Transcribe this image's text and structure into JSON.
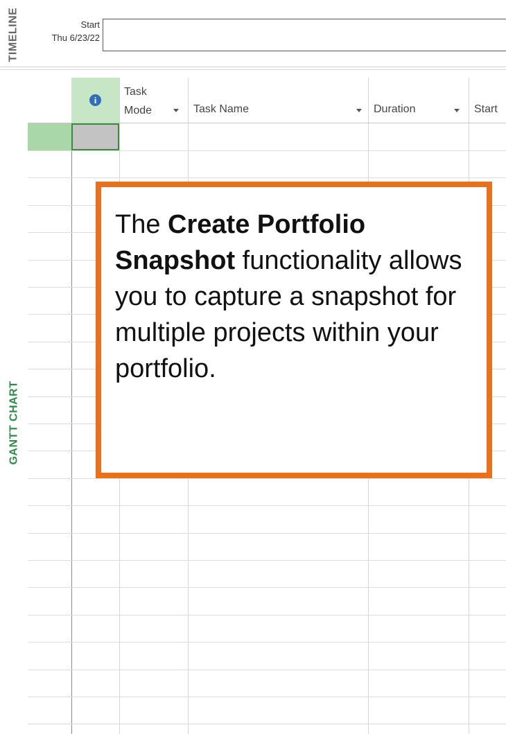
{
  "timeline": {
    "side_title": "TIMELINE",
    "start_label": "Start",
    "start_date": "Thu 6/23/22"
  },
  "gantt": {
    "side_title": "GANTT CHART",
    "columns": {
      "indicator_icon": "info-icon",
      "task_mode_line1": "Task",
      "task_mode_line2": "Mode",
      "task_name": "Task Name",
      "duration": "Duration",
      "start": "Start"
    }
  },
  "callout": {
    "prefix": "The ",
    "bold": "Create Portfolio Snapshot",
    "suffix": " functionality allows you to capture a snapshot for multiple projects within your portfolio.",
    "border_color": "#e8711c"
  },
  "colors": {
    "accent_green": "#2e8b4a",
    "selection_green": "#a9d7a9"
  }
}
